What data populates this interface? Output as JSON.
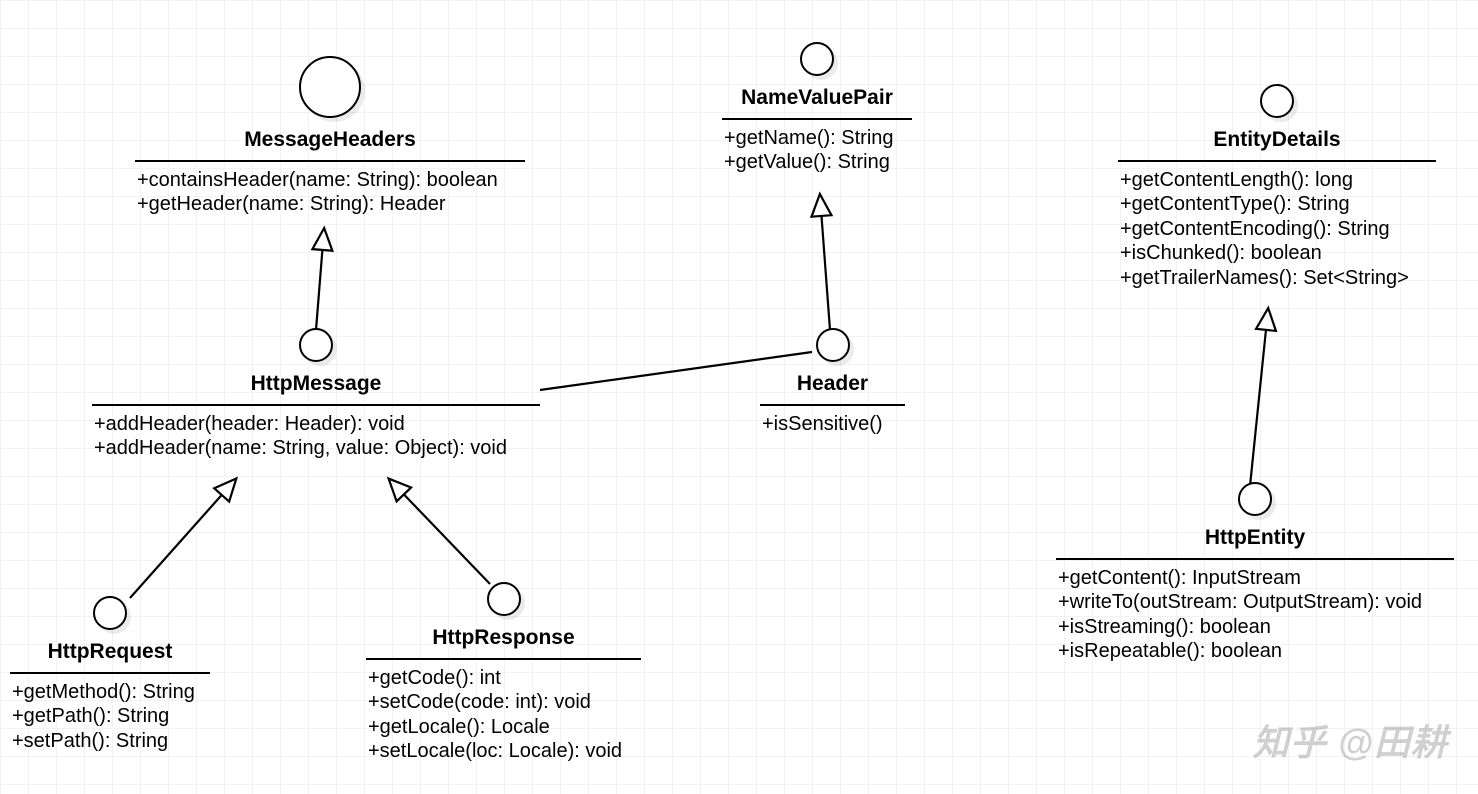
{
  "diagram": {
    "classes": {
      "messageHeaders": {
        "name": "MessageHeaders",
        "methods": [
          "+containsHeader(name: String): boolean",
          "+getHeader(name: String): Header"
        ]
      },
      "httpMessage": {
        "name": "HttpMessage",
        "methods": [
          "+addHeader(header: Header): void",
          "+addHeader(name: String, value: Object): void"
        ]
      },
      "httpRequest": {
        "name": "HttpRequest",
        "methods": [
          "+getMethod(): String",
          "+getPath(): String",
          "+setPath(): String"
        ]
      },
      "httpResponse": {
        "name": "HttpResponse",
        "methods": [
          "+getCode(): int",
          "+setCode(code: int): void",
          "+getLocale(): Locale",
          "+setLocale(loc: Locale): void"
        ]
      },
      "nameValuePair": {
        "name": "NameValuePair",
        "methods": [
          "+getName(): String",
          "+getValue(): String"
        ]
      },
      "header": {
        "name": "Header",
        "methods": [
          "+isSensitive()"
        ]
      },
      "entityDetails": {
        "name": "EntityDetails",
        "methods": [
          "+getContentLength(): long",
          "+getContentType(): String",
          "+getContentEncoding(): String",
          "+isChunked(): boolean",
          "+getTrailerNames(): Set<String>"
        ]
      },
      "httpEntity": {
        "name": "HttpEntity",
        "methods": [
          "+getContent(): InputStream",
          "+writeTo(outStream: OutputStream): void",
          "+isStreaming(): boolean",
          "+isRepeatable(): boolean"
        ]
      }
    },
    "relationships": [
      {
        "from": "HttpMessage",
        "to": "MessageHeaders",
        "type": "generalization"
      },
      {
        "from": "HttpRequest",
        "to": "HttpMessage",
        "type": "generalization"
      },
      {
        "from": "HttpResponse",
        "to": "HttpMessage",
        "type": "generalization"
      },
      {
        "from": "Header",
        "to": "NameValuePair",
        "type": "generalization"
      },
      {
        "from": "HttpEntity",
        "to": "EntityDetails",
        "type": "generalization"
      },
      {
        "from": "HttpMessage",
        "to": "Header",
        "type": "association"
      }
    ]
  },
  "watermark": "知乎 @田耕"
}
